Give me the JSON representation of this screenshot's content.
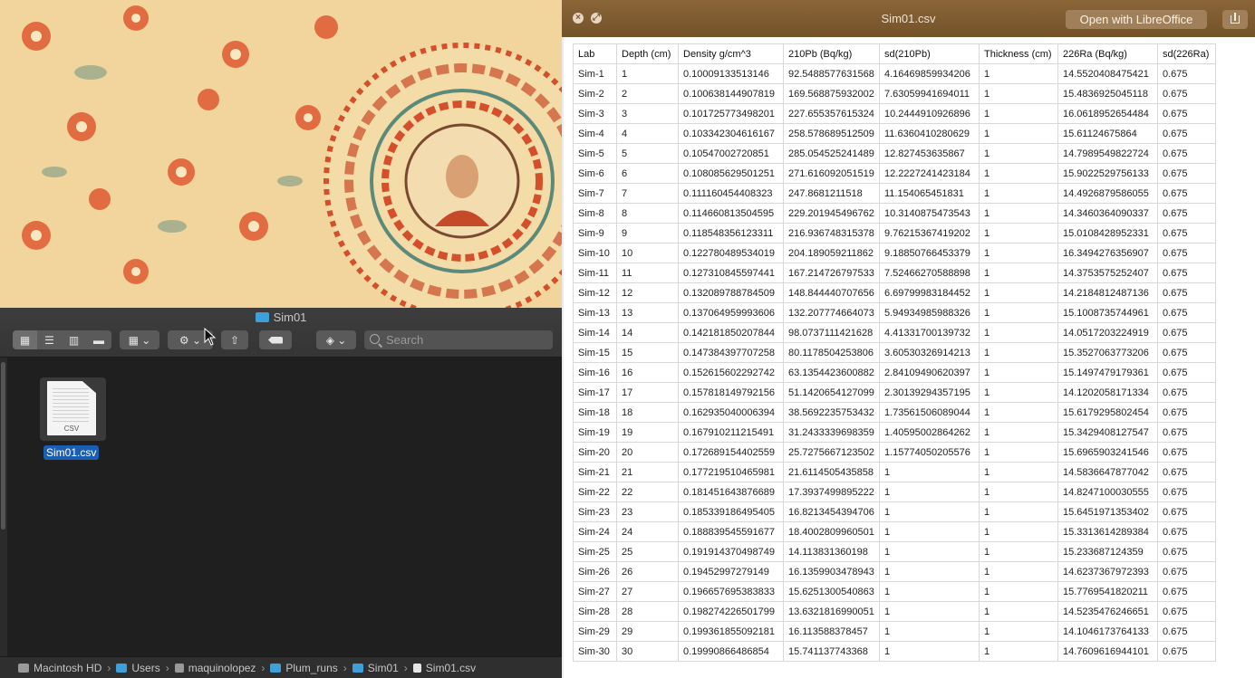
{
  "finder": {
    "window_title": "Sim01",
    "search_placeholder": "Search",
    "file": {
      "name": "Sim01.csv",
      "icon_ext": "CSV"
    },
    "path": [
      "Macintosh HD",
      "Users",
      "maquinolopez",
      "Plum_runs",
      "Sim01",
      "Sim01.csv"
    ]
  },
  "quicklook": {
    "title": "Sim01.csv",
    "open_button": "Open with LibreOffice"
  },
  "table": {
    "headers": [
      "Lab",
      "Depth (cm)",
      "Density g/cm^3",
      "210Pb (Bq/kg)",
      "sd(210Pb)",
      "Thickness (cm)",
      "226Ra (Bq/kg)",
      "sd(226Ra)"
    ],
    "rows": [
      [
        "Sim-1",
        "1",
        "0.10009133513146",
        "92.5488577631568",
        "4.16469859934206",
        "1",
        "14.5520408475421",
        "0.675"
      ],
      [
        "Sim-2",
        "2",
        "0.100638144907819",
        "169.568875932002",
        "7.63059941694011",
        "1",
        "15.4836925045118",
        "0.675"
      ],
      [
        "Sim-3",
        "3",
        "0.101725773498201",
        "227.655357615324",
        "10.2444910926896",
        "1",
        "16.0618952654484",
        "0.675"
      ],
      [
        "Sim-4",
        "4",
        "0.103342304616167",
        "258.578689512509",
        "11.6360410280629",
        "1",
        "15.61124675864",
        "0.675"
      ],
      [
        "Sim-5",
        "5",
        "0.10547002720851",
        "285.054525241489",
        "12.827453635867",
        "1",
        "14.7989549822724",
        "0.675"
      ],
      [
        "Sim-6",
        "6",
        "0.108085629501251",
        "271.616092051519",
        "12.2227241423184",
        "1",
        "15.9022529756133",
        "0.675"
      ],
      [
        "Sim-7",
        "7",
        "0.111160454408323",
        "247.8681211518",
        "11.154065451831",
        "1",
        "14.4926879586055",
        "0.675"
      ],
      [
        "Sim-8",
        "8",
        "0.114660813504595",
        "229.201945496762",
        "10.3140875473543",
        "1",
        "14.3460364090337",
        "0.675"
      ],
      [
        "Sim-9",
        "9",
        "0.118548356123311",
        "216.936748315378",
        "9.76215367419202",
        "1",
        "15.0108428952331",
        "0.675"
      ],
      [
        "Sim-10",
        "10",
        "0.122780489534019",
        "204.189059211862",
        "9.18850766453379",
        "1",
        "16.3494276356907",
        "0.675"
      ],
      [
        "Sim-11",
        "11",
        "0.127310845597441",
        "167.214726797533",
        "7.52466270588898",
        "1",
        "14.3753575252407",
        "0.675"
      ],
      [
        "Sim-12",
        "12",
        "0.132089788784509",
        "148.844440707656",
        "6.69799983184452",
        "1",
        "14.2184812487136",
        "0.675"
      ],
      [
        "Sim-13",
        "13",
        "0.137064959993606",
        "132.207774664073",
        "5.94934985988326",
        "1",
        "15.1008735744961",
        "0.675"
      ],
      [
        "Sim-14",
        "14",
        "0.142181850207844",
        "98.0737111421628",
        "4.41331700139732",
        "1",
        "14.0517203224919",
        "0.675"
      ],
      [
        "Sim-15",
        "15",
        "0.147384397707258",
        "80.1178504253806",
        "3.60530326914213",
        "1",
        "15.3527063773206",
        "0.675"
      ],
      [
        "Sim-16",
        "16",
        "0.152615602292742",
        "63.1354423600882",
        "2.84109490620397",
        "1",
        "15.1497479179361",
        "0.675"
      ],
      [
        "Sim-17",
        "17",
        "0.157818149792156",
        "51.1420654127099",
        "2.30139294357195",
        "1",
        "14.1202058171334",
        "0.675"
      ],
      [
        "Sim-18",
        "18",
        "0.162935040006394",
        "38.5692235753432",
        "1.73561506089044",
        "1",
        "15.6179295802454",
        "0.675"
      ],
      [
        "Sim-19",
        "19",
        "0.167910211215491",
        "31.2433339698359",
        "1.40595002864262",
        "1",
        "15.3429408127547",
        "0.675"
      ],
      [
        "Sim-20",
        "20",
        "0.172689154402559",
        "25.7275667123502",
        "1.15774050205576",
        "1",
        "15.6965903241546",
        "0.675"
      ],
      [
        "Sim-21",
        "21",
        "0.177219510465981",
        "21.6114505435858",
        "1",
        "1",
        "14.5836647877042",
        "0.675"
      ],
      [
        "Sim-22",
        "22",
        "0.181451643876689",
        "17.3937499895222",
        "1",
        "1",
        "14.8247100030555",
        "0.675"
      ],
      [
        "Sim-23",
        "23",
        "0.185339186495405",
        "16.8213454394706",
        "1",
        "1",
        "15.6451971353402",
        "0.675"
      ],
      [
        "Sim-24",
        "24",
        "0.188839545591677",
        "18.4002809960501",
        "1",
        "1",
        "15.3313614289384",
        "0.675"
      ],
      [
        "Sim-25",
        "25",
        "0.191914370498749",
        "14.113831360198",
        "1",
        "1",
        "15.233687124359",
        "0.675"
      ],
      [
        "Sim-26",
        "26",
        "0.19452997279149",
        "16.1359903478943",
        "1",
        "1",
        "14.6237367972393",
        "0.675"
      ],
      [
        "Sim-27",
        "27",
        "0.196657695383833",
        "15.6251300540863",
        "1",
        "1",
        "15.7769541820211",
        "0.675"
      ],
      [
        "Sim-28",
        "28",
        "0.198274226501799",
        "13.6321816990051",
        "1",
        "1",
        "14.5235476246651",
        "0.675"
      ],
      [
        "Sim-29",
        "29",
        "0.199361855092181",
        "16.113588378457",
        "1",
        "1",
        "14.1046173764133",
        "0.675"
      ],
      [
        "Sim-30",
        "30",
        "0.19990866486854",
        "15.741137743368",
        "1",
        "1",
        "14.7609616944101",
        "0.675"
      ]
    ]
  },
  "colors": {
    "ql_titlebar": "#7d5a30",
    "selection": "#1a5fb4",
    "folder": "#3ea0d8"
  }
}
